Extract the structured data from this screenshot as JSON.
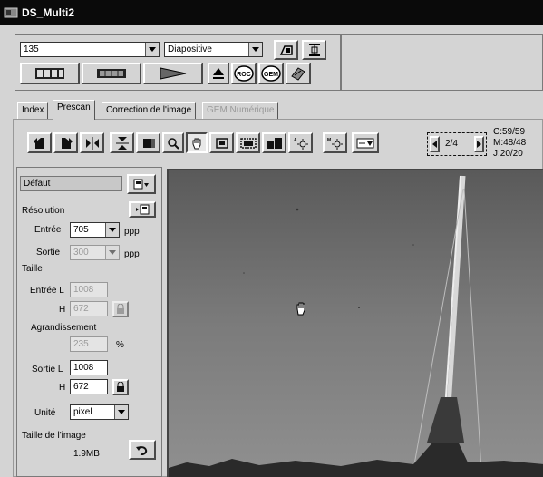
{
  "window": {
    "title": "DS_Multi2"
  },
  "film": {
    "format": "135",
    "type": "Diapositive"
  },
  "toolbar": {
    "icons": [
      "index-scan-icon",
      "prescan-icon",
      "scan-icon",
      "eject-icon",
      "roc-icon",
      "gem-icon",
      "settings-icon",
      "film-icon",
      "frame-icon"
    ],
    "roc_label": "ROC",
    "gem_label": "GEM"
  },
  "tabs": [
    {
      "label": "Index",
      "state": "normal"
    },
    {
      "label": "Prescan",
      "state": "active"
    },
    {
      "label": "Correction de l'image",
      "state": "normal"
    },
    {
      "label": "GEM Numérique",
      "state": "disabled"
    }
  ],
  "frame_nav": {
    "current": "2/4"
  },
  "counters": {
    "c": "C:59/59",
    "m": "M:48/48",
    "j": "J:20/20"
  },
  "settings": {
    "preset": "Défaut",
    "resolution_label": "Résolution",
    "input_label": "Entrée",
    "input_value": "705",
    "input_unit": "ppp",
    "output_label": "Sortie",
    "output_value": "300",
    "output_unit": "ppp",
    "size_label": "Taille",
    "input_w_label": "Entrée L",
    "input_w_value": "1008",
    "input_h_label": "H",
    "input_h_value": "672",
    "enlarge_label": "Agrandissement",
    "enlarge_value": "235",
    "enlarge_unit": "%",
    "output_w_label": "Sortie L",
    "output_w_value": "1008",
    "output_h_label": "H",
    "output_h_value": "672",
    "unit_label": "Unité",
    "unit_value": "pixel",
    "image_size_label": "Taille de l'image",
    "image_size_value": "1.9MB"
  }
}
